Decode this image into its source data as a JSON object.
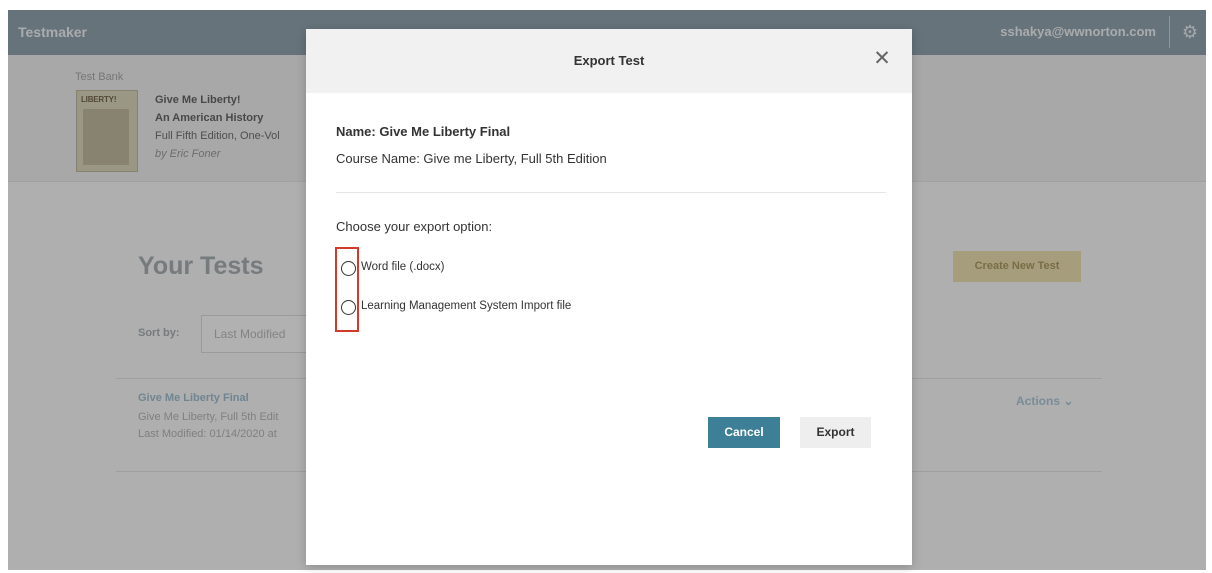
{
  "app": {
    "title": "Testmaker",
    "user_email": "sshakya@wwnorton.com",
    "settings_icon": "gear-icon"
  },
  "test_bank": {
    "label": "Test Bank",
    "cover_text": "LIBERTY!",
    "book_title": "Give Me Liberty!",
    "book_subtitle": "An American History",
    "edition": "Full Fifth Edition, One-Vol",
    "author": "by Eric Foner"
  },
  "tests": {
    "heading": "Your Tests",
    "create_button": "Create New Test",
    "sort_label": "Sort by:",
    "sort_value": "Last Modified",
    "items": [
      {
        "name": "Give Me Liberty Final",
        "course": "Give Me Liberty, Full 5th Edit",
        "modified": "Last Modified: 01/14/2020 at",
        "actions": "Actions ⌄"
      }
    ]
  },
  "modal": {
    "title": "Export Test",
    "close_icon": "close-icon",
    "name_line": "Name: Give Me Liberty Final",
    "course_line": "Course Name: Give me Liberty, Full 5th Edition",
    "prompt": "Choose your export option:",
    "options": [
      {
        "label": "Word file (.docx)",
        "selected": false
      },
      {
        "label": "Learning Management System Import file",
        "selected": false
      }
    ],
    "cancel_label": "Cancel",
    "export_label": "Export"
  },
  "colors": {
    "topbar": "#7f95a3",
    "primary_button": "#3d7f96",
    "highlight_box": "#d23b2a",
    "create_button": "#ecdda6"
  }
}
